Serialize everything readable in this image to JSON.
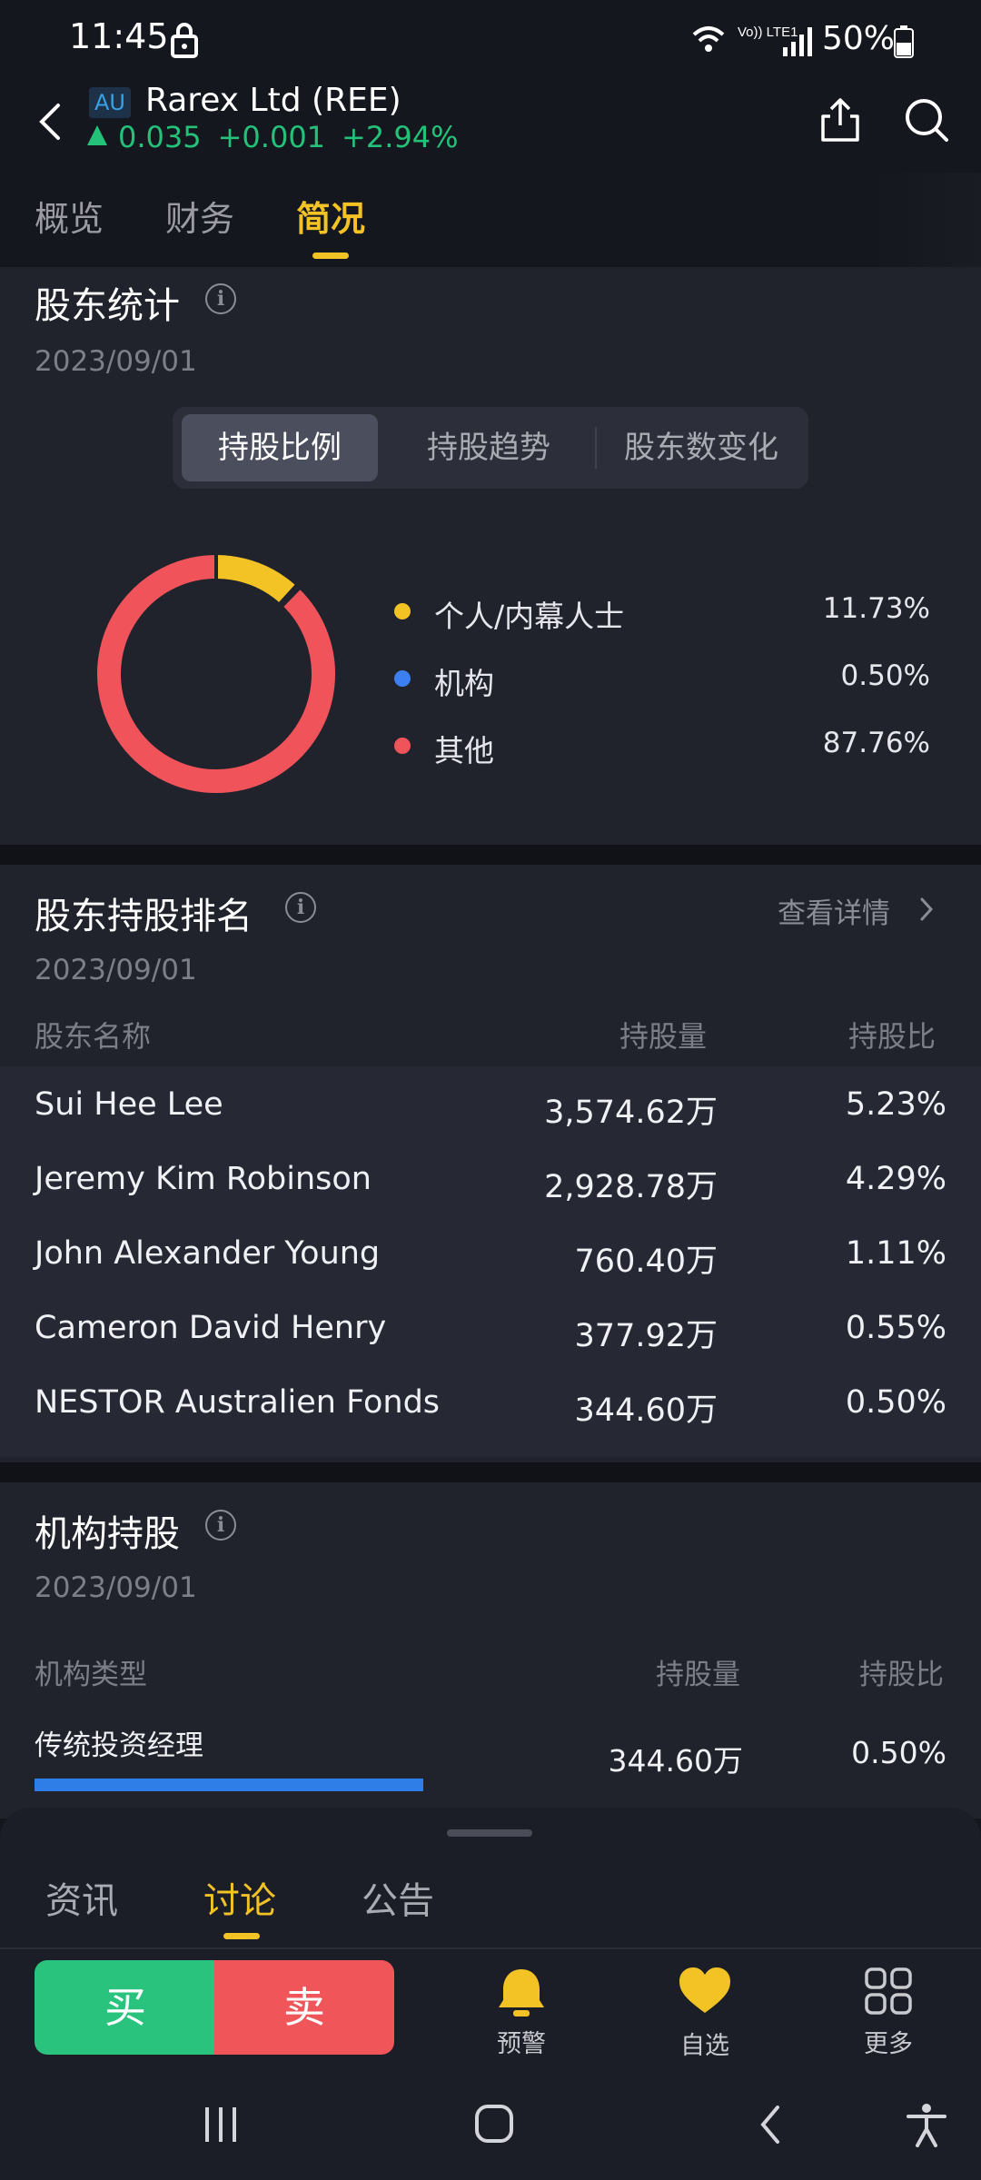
{
  "status_bar": {
    "time": "11:45",
    "network": "Vo)) LTE1",
    "battery": "50%"
  },
  "header": {
    "market_badge": "AU",
    "stock_name": "Rarex Ltd (REE)",
    "price": "0.035",
    "change": "+0.001",
    "change_pct": "+2.94%",
    "up_color": "#24c279"
  },
  "main_tabs": [
    "概览",
    "财务",
    "简况"
  ],
  "main_tab_active": 2,
  "shareholder_stats": {
    "title": "股东统计",
    "date": "2023/09/01",
    "segments": [
      "持股比例",
      "持股趋势",
      "股东数变化"
    ],
    "active_segment": 0,
    "chart_data": {
      "type": "pie",
      "categories": [
        "个人/内幕人士",
        "机构",
        "其他"
      ],
      "values": [
        11.73,
        0.5,
        87.76
      ],
      "labels": [
        "11.73%",
        "0.50%",
        "87.76%"
      ],
      "colors": [
        "#f3c225",
        "#3b7ff0",
        "#f0545a"
      ]
    }
  },
  "holding_rank": {
    "title": "股东持股排名",
    "more": "查看详情",
    "date": "2023/09/01",
    "columns": [
      "股东名称",
      "持股量",
      "持股比"
    ],
    "rows": [
      {
        "name": "Sui Hee Lee",
        "qty": "3,574.62万",
        "pct": "5.23%"
      },
      {
        "name": "Jeremy Kim Robinson",
        "qty": "2,928.78万",
        "pct": "4.29%"
      },
      {
        "name": "John Alexander Young",
        "qty": "760.40万",
        "pct": "1.11%"
      },
      {
        "name": "Cameron David Henry",
        "qty": "377.92万",
        "pct": "0.55%"
      },
      {
        "name": "NESTOR Australien Fonds",
        "qty": "344.60万",
        "pct": "0.50%"
      }
    ]
  },
  "institution": {
    "title": "机构持股",
    "date": "2023/09/01",
    "columns": [
      "机构类型",
      "持股量",
      "持股比"
    ],
    "rows": [
      {
        "type": "传统投资经理",
        "qty": "344.60万",
        "pct": "0.50%"
      }
    ]
  },
  "bottom_tabs": [
    "资讯",
    "讨论",
    "公告"
  ],
  "bottom_tab_active": 1,
  "actions": {
    "buy": "买",
    "sell": "卖",
    "alert": "预警",
    "watchlist": "自选",
    "more": "更多"
  },
  "icons": [
    "lock-icon",
    "wifi-icon",
    "signal-icon",
    "battery-icon",
    "back-icon",
    "share-icon",
    "search-icon",
    "info-icon",
    "chevron-right-icon",
    "bell-icon",
    "heart-icon",
    "grid-icon",
    "recents-icon",
    "home-icon",
    "nav-back-icon",
    "accessibility-icon"
  ]
}
